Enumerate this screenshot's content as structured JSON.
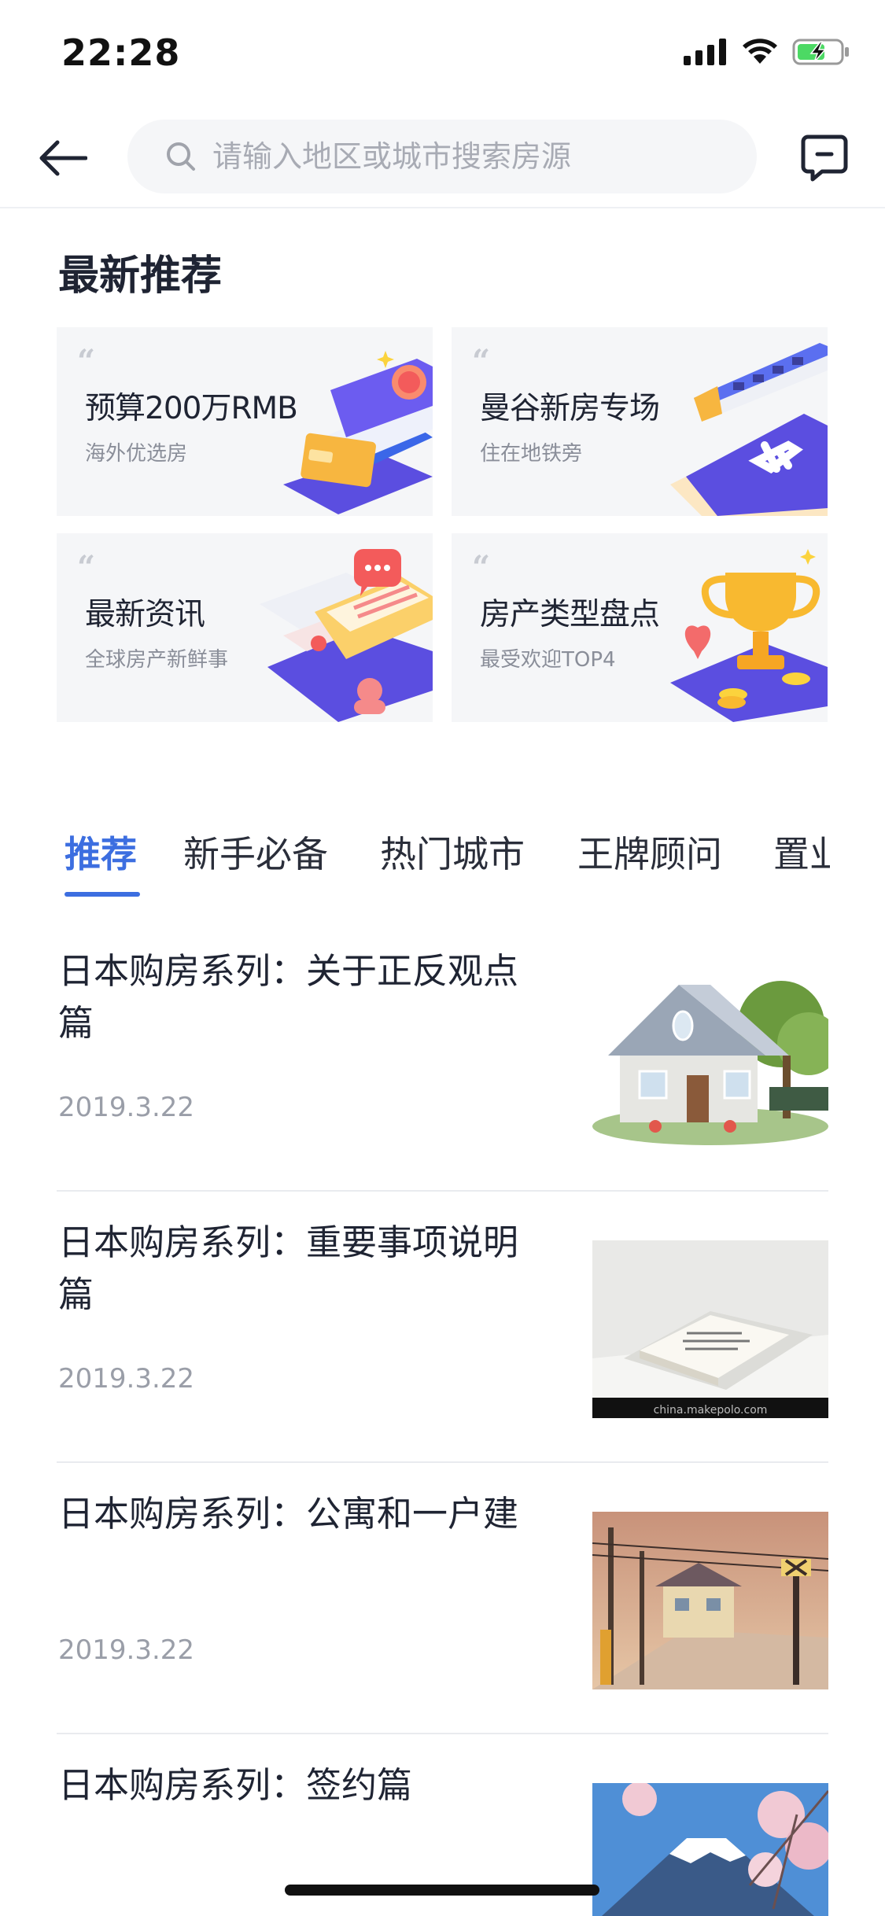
{
  "status_bar": {
    "time": "22:28",
    "signal_icon": "signal-bars-icon",
    "wifi_icon": "wifi-icon",
    "battery_icon": "battery-charging-icon"
  },
  "nav": {
    "back_icon": "arrow-left-icon",
    "search_placeholder": "请输入地区或城市搜索房源",
    "search_icon": "search-icon",
    "message_icon": "chat-bubble-icon"
  },
  "recommend": {
    "title": "最新推荐",
    "cards": [
      {
        "title": "预算200万RMB",
        "subtitle": "海外优选房",
        "icon": "cards-stack-illustration"
      },
      {
        "title": "曼谷新房专场",
        "subtitle": "住在地铁旁",
        "icon": "train-airplane-illustration"
      },
      {
        "title": "最新资讯",
        "subtitle": "全球房产新鲜事",
        "icon": "documents-chat-illustration"
      },
      {
        "title": "房产类型盘点",
        "subtitle": "最受欢迎TOP4",
        "icon": "trophy-illustration"
      }
    ]
  },
  "tabs": [
    {
      "label": "推荐",
      "active": true
    },
    {
      "label": "新手必备",
      "active": false
    },
    {
      "label": "热门城市",
      "active": false
    },
    {
      "label": "王牌顾问",
      "active": false
    },
    {
      "label": "置业",
      "active": false
    }
  ],
  "news": [
    {
      "title": "日本购房系列：关于正反观点篇",
      "date": "2019.3.22",
      "thumb": "house-image"
    },
    {
      "title": "日本购房系列：重要事项说明篇",
      "date": "2019.3.22",
      "thumb": "document-tray-image",
      "thumb_caption": "china.makepolo.com"
    },
    {
      "title": "日本购房系列：公寓和一户建",
      "date": "2019.3.22",
      "thumb": "street-scene-image"
    },
    {
      "title": "日本购房系列：签约篇",
      "date": "",
      "thumb": "mount-fuji-image"
    }
  ],
  "colors": {
    "accent": "#3c6ee0",
    "card_bg": "#f5f6f8",
    "text": "#1f2433",
    "muted": "#9a9ea8"
  }
}
